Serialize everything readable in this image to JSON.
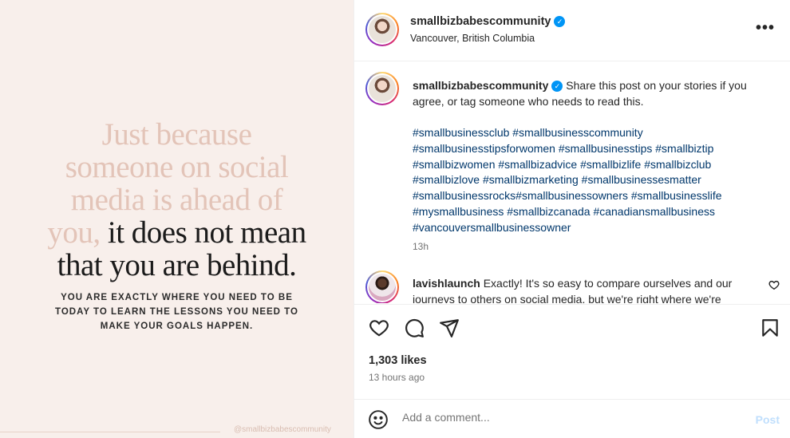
{
  "image": {
    "quote_light": [
      "Just because",
      "someone on social",
      "media is ahead of",
      "you,"
    ],
    "quote_dark_inline": "it does not mean",
    "quote_dark_last": "that you are behind.",
    "subtext": [
      "YOU ARE EXACTLY WHERE YOU NEED TO BE",
      "TODAY TO LEARN THE LESSONS YOU NEED TO",
      "MAKE YOUR GOALS HAPPEN."
    ],
    "watermark": "@smallbizbabescommunity"
  },
  "header": {
    "username": "smallbizbabescommunity",
    "location": "Vancouver, British Columbia",
    "more_label": "•••"
  },
  "caption": {
    "username": "smallbizbabescommunity",
    "text": "Share this post on your stories if you agree, or tag someone who needs to read this.",
    "hashtag_lines": [
      [
        "#smallbusinessclub",
        "#smallbusinesscommunity"
      ],
      [
        "#smallbusinesstipsforwomen",
        "#smallbusinesstips",
        "#smallbiztip"
      ],
      [
        "#smallbizwomen",
        "#smallbizadvice",
        "#smallbizlife",
        "#smallbizclub"
      ],
      [
        "#smallbizlove",
        "#smallbizmarketing",
        "#smallbusinessesmatter"
      ],
      [
        "#smallbusinessrocks#smallbusinessowners",
        "#smallbusinesslife"
      ],
      [
        "#mysmallbusiness",
        "#smallbizcanada",
        "#canadiansmallbusiness"
      ],
      [
        "#vancouversmallbusinessowner"
      ]
    ],
    "time": "13h"
  },
  "comment": {
    "username": "lavishlaunch",
    "text": "Exactly! It's so easy to compare ourselves and our journeys to others on social media, but we're right where we're"
  },
  "stats": {
    "likes": "1,303 likes",
    "posted": "13 hours ago"
  },
  "add_comment": {
    "placeholder": "Add a comment...",
    "post_label": "Post"
  },
  "colors": {
    "verified": "#0095f6",
    "hashtag": "#00376b",
    "post_button_disabled": "#c0dffd",
    "image_bg": "#f8efeb",
    "quote_light": "#e3c4b8"
  }
}
